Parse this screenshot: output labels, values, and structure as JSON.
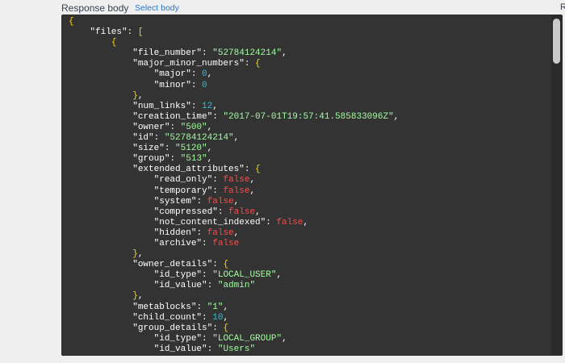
{
  "header": {
    "title": "Response body",
    "select_link": "Select body",
    "edge_text": "R"
  },
  "colors": {
    "key": "#ffffff",
    "string": "#a2fca2",
    "number": "#2ac0e0",
    "boolean": "#fc4b4b",
    "punctuation": "#ffd700"
  },
  "scrollbar": {
    "position_fraction": 0.0
  },
  "code_lines": [
    [
      {
        "t": "p",
        "v": "{"
      }
    ],
    [
      {
        "t": "t",
        "v": "    "
      },
      {
        "t": "k",
        "v": "\"files\""
      },
      {
        "t": "t",
        "v": ": "
      },
      {
        "t": "p",
        "v": "["
      }
    ],
    [
      {
        "t": "t",
        "v": "        "
      },
      {
        "t": "p",
        "v": "{"
      }
    ],
    [
      {
        "t": "t",
        "v": "            "
      },
      {
        "t": "k",
        "v": "\"file_number\""
      },
      {
        "t": "t",
        "v": ": "
      },
      {
        "t": "s",
        "v": "\"52784124214\""
      },
      {
        "t": "t",
        "v": ","
      }
    ],
    [
      {
        "t": "t",
        "v": "            "
      },
      {
        "t": "k",
        "v": "\"major_minor_numbers\""
      },
      {
        "t": "t",
        "v": ": "
      },
      {
        "t": "p",
        "v": "{"
      }
    ],
    [
      {
        "t": "t",
        "v": "                "
      },
      {
        "t": "k",
        "v": "\"major\""
      },
      {
        "t": "t",
        "v": ": "
      },
      {
        "t": "n",
        "v": "0"
      },
      {
        "t": "t",
        "v": ","
      }
    ],
    [
      {
        "t": "t",
        "v": "                "
      },
      {
        "t": "k",
        "v": "\"minor\""
      },
      {
        "t": "t",
        "v": ": "
      },
      {
        "t": "n",
        "v": "0"
      }
    ],
    [
      {
        "t": "t",
        "v": "            "
      },
      {
        "t": "p",
        "v": "}"
      },
      {
        "t": "t",
        "v": ","
      }
    ],
    [
      {
        "t": "t",
        "v": "            "
      },
      {
        "t": "k",
        "v": "\"num_links\""
      },
      {
        "t": "t",
        "v": ": "
      },
      {
        "t": "n",
        "v": "12"
      },
      {
        "t": "t",
        "v": ","
      }
    ],
    [
      {
        "t": "t",
        "v": "            "
      },
      {
        "t": "k",
        "v": "\"creation_time\""
      },
      {
        "t": "t",
        "v": ": "
      },
      {
        "t": "s",
        "v": "\"2017-07-01T19:57:41.585833096Z\""
      },
      {
        "t": "t",
        "v": ","
      }
    ],
    [
      {
        "t": "t",
        "v": "            "
      },
      {
        "t": "k",
        "v": "\"owner\""
      },
      {
        "t": "t",
        "v": ": "
      },
      {
        "t": "s",
        "v": "\"500\""
      },
      {
        "t": "t",
        "v": ","
      }
    ],
    [
      {
        "t": "t",
        "v": "            "
      },
      {
        "t": "k",
        "v": "\"id\""
      },
      {
        "t": "t",
        "v": ": "
      },
      {
        "t": "s",
        "v": "\"52784124214\""
      },
      {
        "t": "t",
        "v": ","
      }
    ],
    [
      {
        "t": "t",
        "v": "            "
      },
      {
        "t": "k",
        "v": "\"size\""
      },
      {
        "t": "t",
        "v": ": "
      },
      {
        "t": "s",
        "v": "\"5120\""
      },
      {
        "t": "t",
        "v": ","
      }
    ],
    [
      {
        "t": "t",
        "v": "            "
      },
      {
        "t": "k",
        "v": "\"group\""
      },
      {
        "t": "t",
        "v": ": "
      },
      {
        "t": "s",
        "v": "\"513\""
      },
      {
        "t": "t",
        "v": ","
      }
    ],
    [
      {
        "t": "t",
        "v": "            "
      },
      {
        "t": "k",
        "v": "\"extended_attributes\""
      },
      {
        "t": "t",
        "v": ": "
      },
      {
        "t": "p",
        "v": "{"
      }
    ],
    [
      {
        "t": "t",
        "v": "                "
      },
      {
        "t": "k",
        "v": "\"read_only\""
      },
      {
        "t": "t",
        "v": ": "
      },
      {
        "t": "b",
        "v": "false"
      },
      {
        "t": "t",
        "v": ","
      }
    ],
    [
      {
        "t": "t",
        "v": "                "
      },
      {
        "t": "k",
        "v": "\"temporary\""
      },
      {
        "t": "t",
        "v": ": "
      },
      {
        "t": "b",
        "v": "false"
      },
      {
        "t": "t",
        "v": ","
      }
    ],
    [
      {
        "t": "t",
        "v": "                "
      },
      {
        "t": "k",
        "v": "\"system\""
      },
      {
        "t": "t",
        "v": ": "
      },
      {
        "t": "b",
        "v": "false"
      },
      {
        "t": "t",
        "v": ","
      }
    ],
    [
      {
        "t": "t",
        "v": "                "
      },
      {
        "t": "k",
        "v": "\"compressed\""
      },
      {
        "t": "t",
        "v": ": "
      },
      {
        "t": "b",
        "v": "false"
      },
      {
        "t": "t",
        "v": ","
      }
    ],
    [
      {
        "t": "t",
        "v": "                "
      },
      {
        "t": "k",
        "v": "\"not_content_indexed\""
      },
      {
        "t": "t",
        "v": ": "
      },
      {
        "t": "b",
        "v": "false"
      },
      {
        "t": "t",
        "v": ","
      }
    ],
    [
      {
        "t": "t",
        "v": "                "
      },
      {
        "t": "k",
        "v": "\"hidden\""
      },
      {
        "t": "t",
        "v": ": "
      },
      {
        "t": "b",
        "v": "false"
      },
      {
        "t": "t",
        "v": ","
      }
    ],
    [
      {
        "t": "t",
        "v": "                "
      },
      {
        "t": "k",
        "v": "\"archive\""
      },
      {
        "t": "t",
        "v": ": "
      },
      {
        "t": "b",
        "v": "false"
      }
    ],
    [
      {
        "t": "t",
        "v": "            "
      },
      {
        "t": "p",
        "v": "}"
      },
      {
        "t": "t",
        "v": ","
      }
    ],
    [
      {
        "t": "t",
        "v": "            "
      },
      {
        "t": "k",
        "v": "\"owner_details\""
      },
      {
        "t": "t",
        "v": ": "
      },
      {
        "t": "p",
        "v": "{"
      }
    ],
    [
      {
        "t": "t",
        "v": "                "
      },
      {
        "t": "k",
        "v": "\"id_type\""
      },
      {
        "t": "t",
        "v": ": "
      },
      {
        "t": "s",
        "v": "\"LOCAL_USER\""
      },
      {
        "t": "t",
        "v": ","
      }
    ],
    [
      {
        "t": "t",
        "v": "                "
      },
      {
        "t": "k",
        "v": "\"id_value\""
      },
      {
        "t": "t",
        "v": ": "
      },
      {
        "t": "s",
        "v": "\"admin\""
      }
    ],
    [
      {
        "t": "t",
        "v": "            "
      },
      {
        "t": "p",
        "v": "}"
      },
      {
        "t": "t",
        "v": ","
      }
    ],
    [
      {
        "t": "t",
        "v": "            "
      },
      {
        "t": "k",
        "v": "\"metablocks\""
      },
      {
        "t": "t",
        "v": ": "
      },
      {
        "t": "s",
        "v": "\"1\""
      },
      {
        "t": "t",
        "v": ","
      }
    ],
    [
      {
        "t": "t",
        "v": "            "
      },
      {
        "t": "k",
        "v": "\"child_count\""
      },
      {
        "t": "t",
        "v": ": "
      },
      {
        "t": "n",
        "v": "10"
      },
      {
        "t": "t",
        "v": ","
      }
    ],
    [
      {
        "t": "t",
        "v": "            "
      },
      {
        "t": "k",
        "v": "\"group_details\""
      },
      {
        "t": "t",
        "v": ": "
      },
      {
        "t": "p",
        "v": "{"
      }
    ],
    [
      {
        "t": "t",
        "v": "                "
      },
      {
        "t": "k",
        "v": "\"id_type\""
      },
      {
        "t": "t",
        "v": ": "
      },
      {
        "t": "s",
        "v": "\"LOCAL_GROUP\""
      },
      {
        "t": "t",
        "v": ","
      }
    ],
    [
      {
        "t": "t",
        "v": "                "
      },
      {
        "t": "k",
        "v": "\"id_value\""
      },
      {
        "t": "t",
        "v": ": "
      },
      {
        "t": "s",
        "v": "\"Users\""
      }
    ]
  ]
}
